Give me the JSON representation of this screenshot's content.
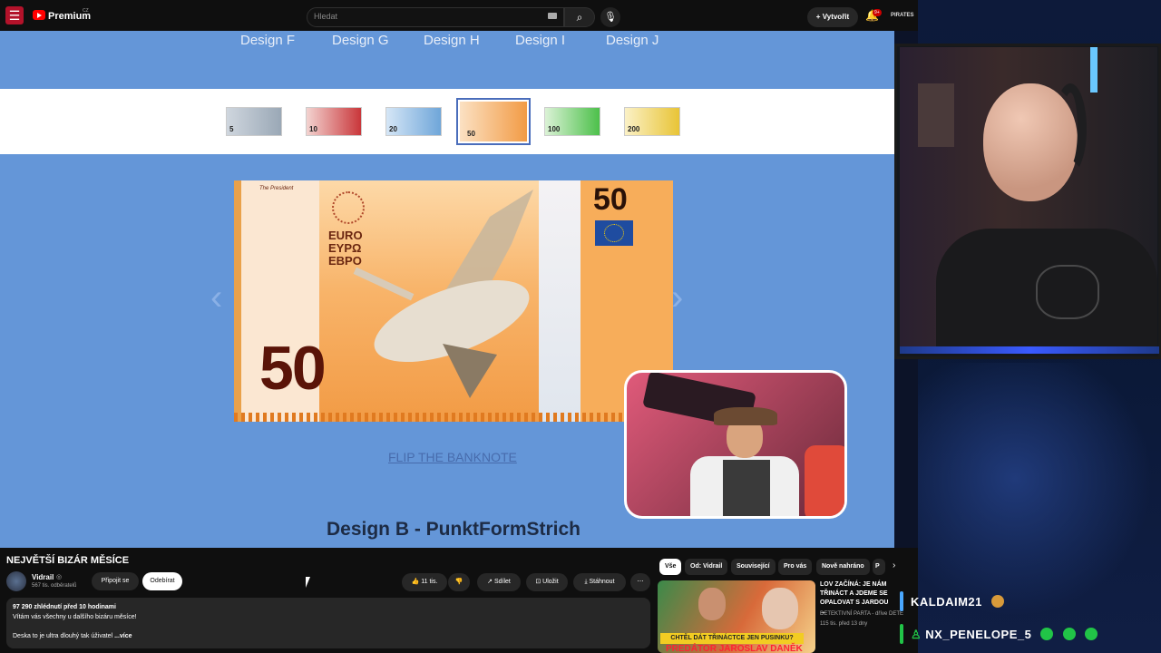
{
  "youtube": {
    "brand": "Premium",
    "brand_region": "CZ",
    "search_placeholder": "Hledat",
    "create_label": "Vytvořit",
    "notif_badge": "9+",
    "avatar_text": "PIRATES"
  },
  "video_frame": {
    "design_tabs": [
      "Design F",
      "Design G",
      "Design H",
      "Design I",
      "Design J"
    ],
    "denominations": [
      "5",
      "10",
      "20",
      "50",
      "100",
      "200"
    ],
    "selected_denomination": "50",
    "banknote": {
      "header": "The President",
      "title": "EURO\nEYPΩ\nEBPO",
      "value_big": "50",
      "value_small": "50"
    },
    "flip_link": "FLIP THE BANKNOTE",
    "caption": "Design B - PunktFormStrich"
  },
  "video_info": {
    "title": "NEJVĚTŠÍ BIZÁR MĚSÍCE",
    "channel": "Vidrail",
    "subscribers": "567 tis. odběratelů",
    "join_label": "Připojit se",
    "subscribe_label": "Odebírat",
    "likes": "11 tis.",
    "share_label": "Sdílet",
    "save_label": "Uložit",
    "download_label": "Stáhnout",
    "views_line": "97 290 zhlédnutí  před 10 hodinami",
    "desc_line1": "Vítám vás všechny u dalšího bizáru měsíce!",
    "desc_line2": "Deska to je ultra dlouhý tak úživatel",
    "more_label": "...více"
  },
  "filters": [
    "Vše",
    "Od: Vidrail",
    "Související",
    "Pro vás",
    "Nově nahráno",
    "P"
  ],
  "recommended": {
    "title": "LOV ZAČÍNÁ: JE NÁM TŘINÁCT A JDEME SE OPALOVAT S JARDOU ...",
    "channel": "DETEKTIVNÍ PARTA - dříve DETE",
    "meta": "115 tis.   před 13 dny",
    "banner": "CHTĚL DÁT TŘINÁCTCE JEN PUSINKU?",
    "big_text": "PREDÁTOR JAROSLAV DANĚK"
  },
  "chat": [
    {
      "user": "KALDAIM21",
      "color": "#4aa8ff"
    },
    {
      "user": "NX_PENELOPE_5",
      "color": "#21c447"
    }
  ]
}
